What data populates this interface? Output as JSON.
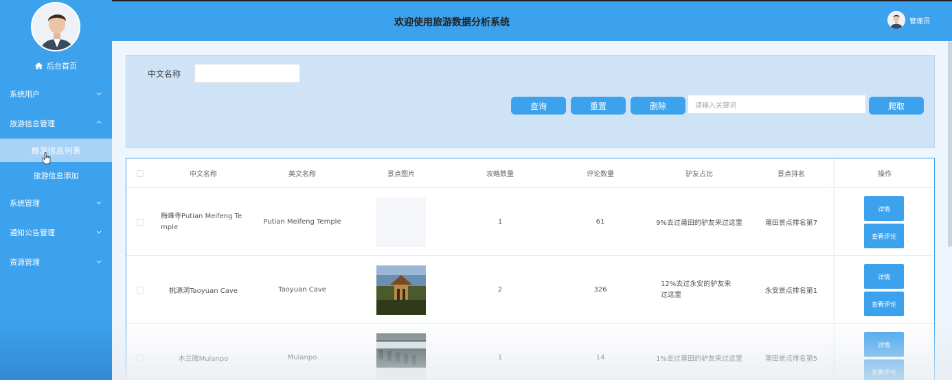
{
  "header": {
    "title": "欢迎使用旅游数据分析系统",
    "user_label": "管理员"
  },
  "sidebar": {
    "home_label": "后台首页",
    "menus": [
      {
        "label": "系统用户",
        "expanded": false
      },
      {
        "label": "旅游信息管理",
        "expanded": true
      },
      {
        "label": "系统管理",
        "expanded": false
      },
      {
        "label": "通知公告管理",
        "expanded": false
      },
      {
        "label": "资源管理",
        "expanded": false
      }
    ],
    "sub_items": [
      {
        "label": "旅游信息列表",
        "active": true
      },
      {
        "label": "旅游信息添加",
        "active": false
      }
    ]
  },
  "search": {
    "field_label": "中文名称",
    "field_value": "",
    "query_label": "查询",
    "reset_label": "重置",
    "delete_label": "删除",
    "keyword_placeholder": "请输入关键词",
    "crawl_label": "爬取"
  },
  "table": {
    "columns": [
      "中文名称",
      "英文名称",
      "景点图片",
      "攻略数量",
      "评论数量",
      "驴友占比",
      "景点排名",
      "操作"
    ],
    "rows": [
      {
        "name_cn": "梅峰寺Putian Meifeng Temple",
        "name_en": "Putian Meifeng Temple",
        "image": "empty",
        "guides": "1",
        "comments": "61",
        "ratio": "9%去过莆田的驴友来过这里",
        "rank": "莆田景点排名第7",
        "detail_label": "详情",
        "comment_label": "查看评论"
      },
      {
        "name_cn": "桃源洞Taoyuan Cave",
        "name_en": "Taoyuan Cave",
        "image": "pavilion-photo",
        "guides": "2",
        "comments": "326",
        "ratio": "12%去过永安的驴友来过这里",
        "rank": "永安景点排名第1",
        "detail_label": "详情",
        "comment_label": "查看评论"
      },
      {
        "name_cn": "木兰陂Mulanpo",
        "name_en": "Mulanpo",
        "image": "dam-photo",
        "guides": "1",
        "comments": "14",
        "ratio": "1%去过莆田的驴友来过这里",
        "rank": "莆田景点排名第5",
        "detail_label": "详情",
        "comment_label": "查看评论"
      }
    ]
  },
  "colors": {
    "primary": "#3da2ed",
    "panel": "#cfe3f7"
  }
}
